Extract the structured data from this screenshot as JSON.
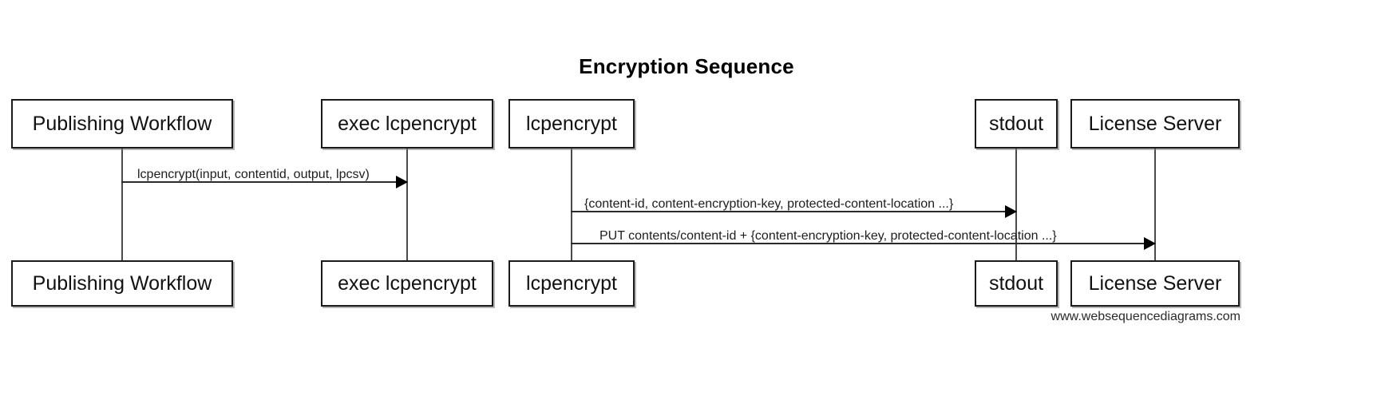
{
  "diagram": {
    "title": "Encryption Sequence",
    "watermark": "www.websequencediagrams.com",
    "colors": {
      "background": "#ffffff",
      "box_border": "#1a1a1a",
      "lifeline": "#4a4a4a",
      "message_line": "#2b2b2b",
      "text": "#000000"
    },
    "participants": [
      {
        "id": "publishing-workflow",
        "label": "Publishing Workflow"
      },
      {
        "id": "exec-lcpencrypt",
        "label": "exec lcpencrypt"
      },
      {
        "id": "lcpencrypt",
        "label": "lcpencrypt"
      },
      {
        "id": "stdout",
        "label": "stdout"
      },
      {
        "id": "license-server",
        "label": "License Server"
      }
    ],
    "messages": [
      {
        "id": "msg-1",
        "label": "lcpencrypt(input, contentid, output, lpcsv)",
        "from": "publishing-workflow",
        "to": "exec-lcpencrypt",
        "direction": "right",
        "arrow": "solid"
      },
      {
        "id": "msg-2",
        "label": "{content-id, content-encryption-key, protected-content-location ...}",
        "from": "lcpencrypt",
        "to": "stdout",
        "direction": "right",
        "arrow": "solid"
      },
      {
        "id": "msg-3",
        "label": "PUT contents/content-id + {content-encryption-key, protected-content-location ...}",
        "from": "lcpencrypt",
        "to": "license-server",
        "direction": "right",
        "arrow": "solid"
      }
    ]
  }
}
